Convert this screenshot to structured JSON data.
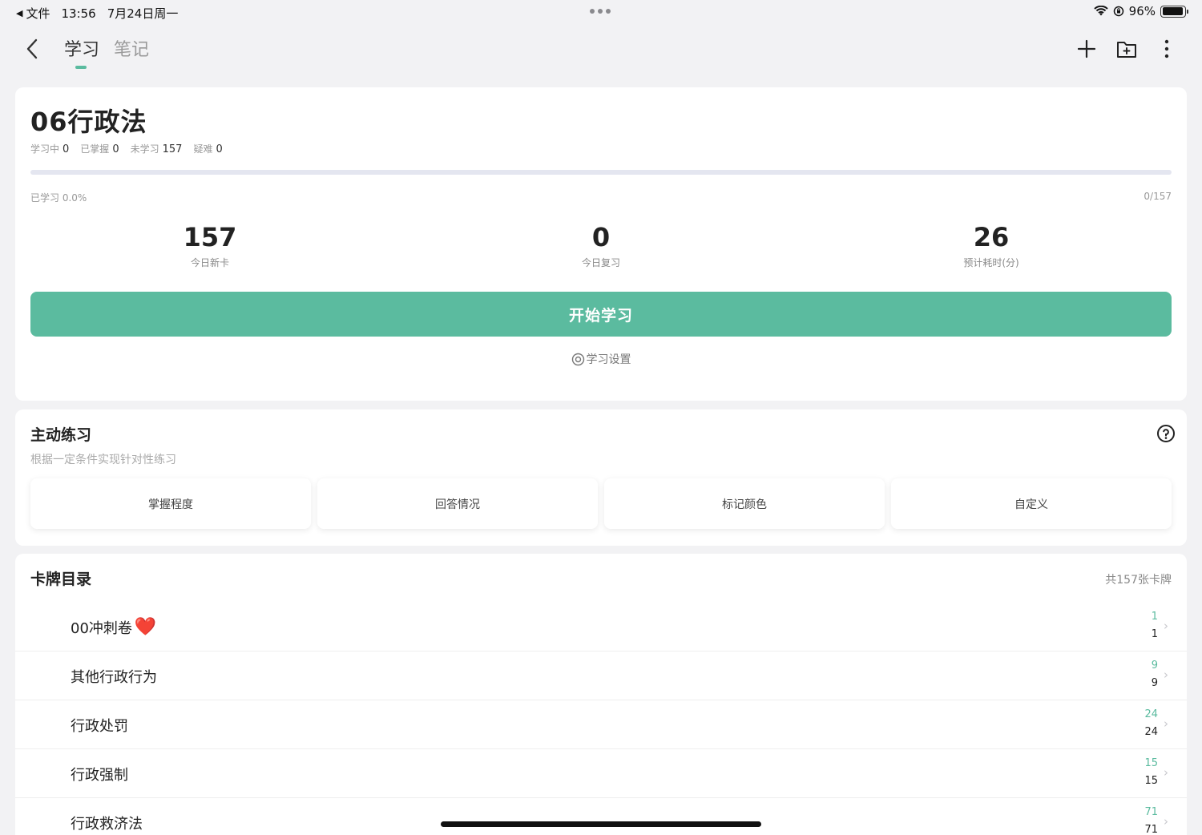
{
  "status_bar": {
    "back_app": "文件",
    "time": "13:56",
    "date": "7月24日周一",
    "battery": "96%",
    "battery_level": 0.96
  },
  "nav": {
    "tabs": [
      {
        "label": "学习",
        "active": true
      },
      {
        "label": "笔记",
        "active": false
      }
    ],
    "icons": [
      "chevron-left-icon",
      "plus-icon",
      "folder-add-icon",
      "more-vertical-icon"
    ]
  },
  "deck": {
    "title": "06行政法",
    "stats": [
      {
        "label": "学习中",
        "value": "0"
      },
      {
        "label": "已掌握",
        "value": "0"
      },
      {
        "label": "未学习",
        "value": "157"
      },
      {
        "label": "疑难",
        "value": "0"
      }
    ],
    "progress_label": "已学习 0.0%",
    "progress_count": "0/157",
    "progress_fraction": 0.0,
    "metrics": [
      {
        "value": "157",
        "label": "今日新卡"
      },
      {
        "value": "0",
        "label": "今日复习"
      },
      {
        "value": "26",
        "label": "预计耗时(分)"
      }
    ],
    "start_button": "开始学习",
    "settings_link": "学习设置"
  },
  "practice": {
    "title": "主动练习",
    "subtitle": "根据一定条件实现针对性练习",
    "buttons": [
      "掌握程度",
      "回答情况",
      "标记颜色",
      "自定义"
    ]
  },
  "catalog": {
    "title": "卡牌目录",
    "total": "共157张卡牌",
    "items": [
      {
        "name": "00冲刺卷",
        "heart": "❤️",
        "new": "1",
        "total": "1"
      },
      {
        "name": "其他行政行为",
        "heart": "",
        "new": "9",
        "total": "9"
      },
      {
        "name": "行政处罚",
        "heart": "",
        "new": "24",
        "total": "24"
      },
      {
        "name": "行政强制",
        "heart": "",
        "new": "15",
        "total": "15"
      },
      {
        "name": "行政救济法",
        "heart": "",
        "new": "71",
        "total": "71"
      }
    ]
  },
  "colors": {
    "accent": "#5bbb9f",
    "background": "#f2f2f4",
    "card": "#ffffff"
  }
}
